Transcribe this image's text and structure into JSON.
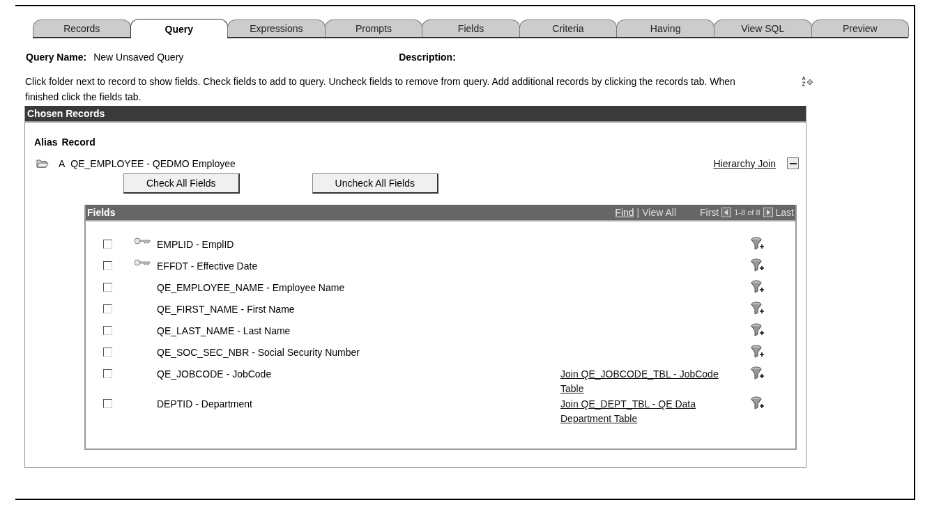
{
  "tabs": [
    {
      "label": "Records",
      "selected": false
    },
    {
      "label": "Query",
      "selected": true
    },
    {
      "label": "Expressions",
      "selected": false
    },
    {
      "label": "Prompts",
      "selected": false
    },
    {
      "label": "Fields",
      "selected": false
    },
    {
      "label": "Criteria",
      "selected": false
    },
    {
      "label": "Having",
      "selected": false
    },
    {
      "label": "View SQL",
      "selected": false
    },
    {
      "label": "Preview",
      "selected": false
    }
  ],
  "query_name": {
    "label": "Query Name:",
    "value": "New Unsaved Query"
  },
  "description": {
    "label": "Description:"
  },
  "instructions": "Click folder next to record to show fields. Check fields to add to query. Uncheck fields to remove from query. Add additional records by clicking the records tab. When finished click the fields tab.",
  "chosen_records": {
    "title": "Chosen Records",
    "columns": [
      "Alias",
      "Record"
    ],
    "record": {
      "alias": "A",
      "name": "QE_EMPLOYEE - QEDMO Employee",
      "link": "Hierarchy Join"
    },
    "buttons": [
      "Check All Fields",
      "Uncheck All Fields"
    ],
    "fields_grid": {
      "title": "Fields",
      "find": "Find",
      "separator": "|",
      "view_all": "View All",
      "first": "First",
      "range": "1-8 of 8",
      "last": "Last",
      "rows": [
        {
          "checked": false,
          "key": true,
          "label": "EMPLID - EmplID"
        },
        {
          "checked": false,
          "key": true,
          "label": "EFFDT - Effective Date"
        },
        {
          "checked": false,
          "key": false,
          "label": "QE_EMPLOYEE_NAME - Employee Name"
        },
        {
          "checked": false,
          "key": false,
          "label": "QE_FIRST_NAME - First Name"
        },
        {
          "checked": false,
          "key": false,
          "label": "QE_LAST_NAME - Last Name"
        },
        {
          "checked": false,
          "key": false,
          "label": "QE_SOC_SEC_NBR - Social Security Number"
        },
        {
          "checked": false,
          "key": false,
          "label": "QE_JOBCODE - JobCode",
          "join": "Join QE_JOBCODE_TBL - JobCode Table"
        },
        {
          "checked": false,
          "key": false,
          "label": "DEPTID - Department",
          "join": "Join QE_DEPT_TBL - QE Data Department Table"
        }
      ]
    }
  }
}
